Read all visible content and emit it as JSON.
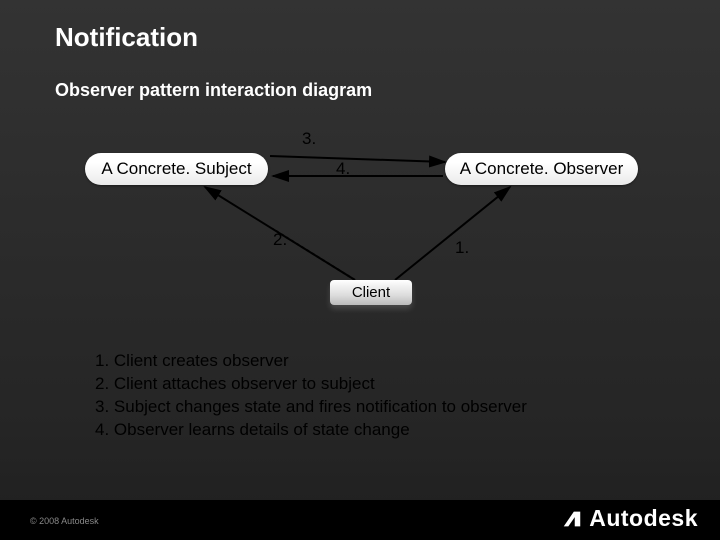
{
  "title": "Notification",
  "subtitle": "Observer pattern interaction diagram",
  "diagram": {
    "subject": "A Concrete. Subject",
    "observer": "A Concrete. Observer",
    "client": "Client",
    "labels": {
      "n1": "1.",
      "n2": "2.",
      "n3": "3.",
      "n4": "4."
    }
  },
  "steps": {
    "s1": "1. Client creates observer",
    "s2": "2. Client attaches observer to subject",
    "s3": "3. Subject changes state and fires notification to observer",
    "s4": "4. Observer learns details of state change"
  },
  "footer": {
    "copyright": "© 2008 Autodesk",
    "brand": "Autodesk"
  }
}
